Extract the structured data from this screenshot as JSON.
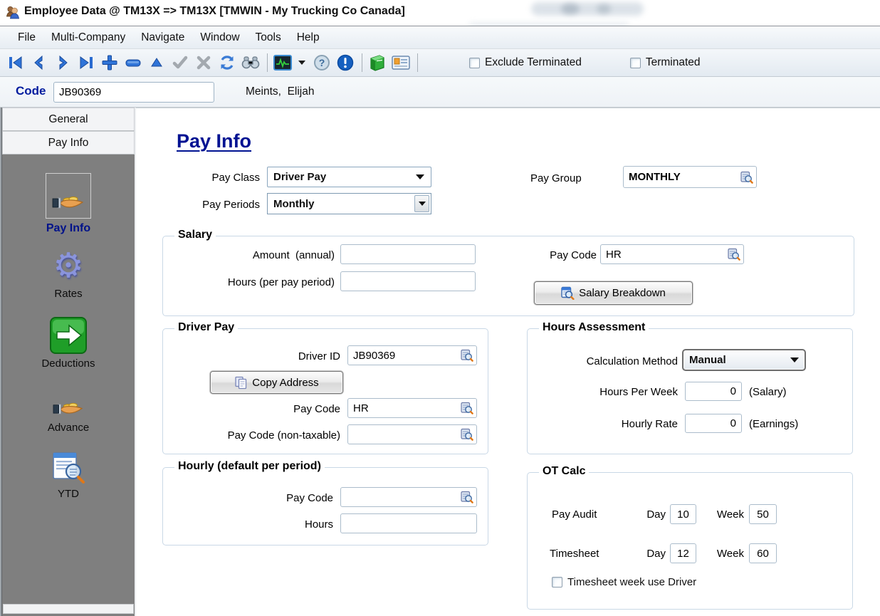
{
  "window": {
    "title": "Employee Data @ TM13X => TM13X [TMWIN - My Trucking Co Canada]"
  },
  "menu": {
    "items": [
      "File",
      "Multi-Company",
      "Navigate",
      "Window",
      "Tools",
      "Help"
    ]
  },
  "toolbar": {
    "icons": [
      "first-record",
      "previous-record",
      "next-record",
      "last-record",
      "add-record",
      "delete-record",
      "sort-ascending",
      "confirm",
      "cancel",
      "refresh",
      "find",
      "terminal",
      "help",
      "alert",
      "manual",
      "employee-card"
    ],
    "exclude_terminated": {
      "label": "Exclude Terminated",
      "checked": false
    },
    "terminated": {
      "label": "Terminated",
      "checked": false
    }
  },
  "record_bar": {
    "code_label": "Code",
    "code_value": "JB90369",
    "employee_name": "Meints,  Elijah"
  },
  "sidebar": {
    "tabs": [
      {
        "label": "General"
      },
      {
        "label": "Pay Info"
      }
    ],
    "items": [
      {
        "label": "Pay Info"
      },
      {
        "label": "Rates"
      },
      {
        "label": "Deductions"
      },
      {
        "label": "Advance"
      },
      {
        "label": "YTD"
      }
    ]
  },
  "main": {
    "heading": "Pay Info",
    "pay_class": {
      "label": "Pay Class",
      "value": "Driver Pay"
    },
    "pay_periods": {
      "label": "Pay Periods",
      "value": "Monthly"
    },
    "pay_group": {
      "label": "Pay Group",
      "value": "MONTHLY"
    },
    "salary": {
      "legend": "Salary",
      "amount_label": "Amount  (annual)",
      "amount_value": "",
      "hours_label": "Hours (per pay period)",
      "hours_value": "",
      "pay_code_label": "Pay Code",
      "pay_code_value": "HR",
      "breakdown_button": "Salary Breakdown"
    },
    "driver_pay": {
      "legend": "Driver Pay",
      "driver_id_label": "Driver ID",
      "driver_id_value": "JB90369",
      "copy_address_button": "Copy Address",
      "pay_code_label": "Pay Code",
      "pay_code_value": "HR",
      "pay_code_nt_label": "Pay Code (non-taxable)",
      "pay_code_nt_value": ""
    },
    "hours_assessment": {
      "legend": "Hours Assessment",
      "calc_method_label": "Calculation Method",
      "calc_method_value": "Manual",
      "hours_per_week_label": "Hours Per Week",
      "hours_per_week_value": "0",
      "hours_per_week_suffix": "(Salary)",
      "hourly_rate_label": "Hourly Rate",
      "hourly_rate_value": "0",
      "hourly_rate_suffix": "(Earnings)"
    },
    "hourly": {
      "legend": "Hourly (default per period)",
      "pay_code_label": "Pay Code",
      "pay_code_value": "",
      "hours_label": "Hours",
      "hours_value": ""
    },
    "ot_calc": {
      "legend": "OT Calc",
      "pay_audit_label": "Pay Audit",
      "timesheet_label": "Timesheet",
      "day_label": "Day",
      "week_label": "Week",
      "pay_audit_day": "10",
      "pay_audit_week": "50",
      "timesheet_day": "12",
      "timesheet_week": "60",
      "timesheet_week_use_driver_label": "Timesheet week use Driver",
      "timesheet_week_use_driver_checked": false
    }
  },
  "colors": {
    "accent_navy": "#001292",
    "sidebar_gray": "#7f7f7f",
    "toolbar_blue": "#2a6bd0"
  }
}
